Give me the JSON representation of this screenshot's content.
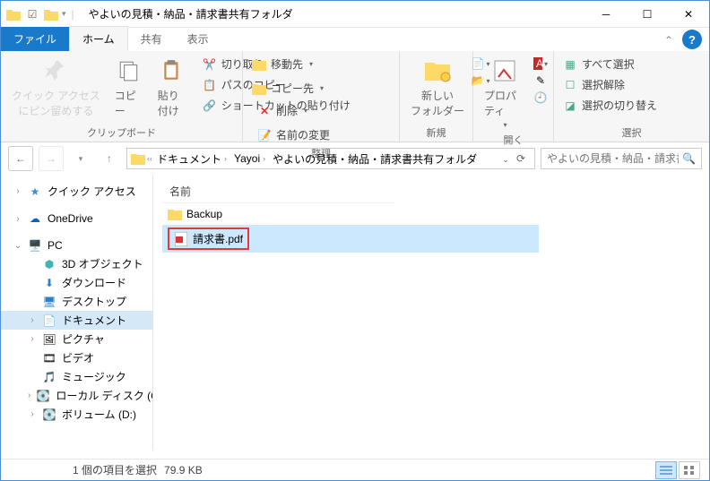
{
  "title": "やよいの見積・納品・請求書共有フォルダ",
  "tabs": {
    "file": "ファイル",
    "home": "ホーム",
    "share": "共有",
    "view": "表示"
  },
  "ribbon": {
    "clipboard": {
      "label": "クリップボード",
      "quickaccess": "クイック アクセス\nにピン留めする",
      "copy": "コピー",
      "paste": "貼り付け",
      "cut": "切り取り",
      "copypath": "パスのコピー",
      "shortcut": "ショートカットの貼り付け"
    },
    "organize": {
      "label": "整理",
      "moveto": "移動先",
      "copyto": "コピー先",
      "delete": "削除",
      "rename": "名前の変更"
    },
    "new": {
      "label": "新規",
      "newfolder": "新しい\nフォルダー"
    },
    "open": {
      "label": "開く",
      "properties": "プロパティ"
    },
    "select": {
      "label": "選択",
      "selectall": "すべて選択",
      "selectnone": "選択解除",
      "invert": "選択の切り替え"
    }
  },
  "breadcrumb": {
    "documents": "ドキュメント",
    "yayoi": "Yayoi",
    "folder": "やよいの見積・納品・請求書共有フォルダ"
  },
  "search_placeholder": "やよいの見積・納品・請求書共...",
  "sidebar": {
    "quickaccess": "クイック アクセス",
    "onedrive": "OneDrive",
    "pc": "PC",
    "pc_items": [
      "3D オブジェクト",
      "ダウンロード",
      "デスクトップ",
      "ドキュメント",
      "ピクチャ",
      "ビデオ",
      "ミュージック",
      "ローカル ディスク (C",
      "ボリューム (D:)"
    ]
  },
  "columns": {
    "name": "名前"
  },
  "files": [
    {
      "name": "Backup",
      "type": "folder"
    },
    {
      "name": "請求書.pdf",
      "type": "pdf",
      "selected": true,
      "highlighted": true
    }
  ],
  "status": {
    "selection": "1 個の項目を選択",
    "size": "79.9 KB"
  }
}
